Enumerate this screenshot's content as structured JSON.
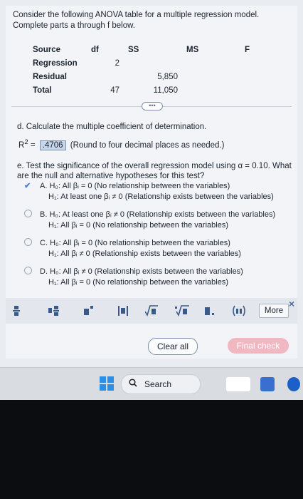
{
  "intro": "Consider the following ANOVA table for a multiple regression model. Complete parts a through f below.",
  "anova": {
    "headers": [
      "Source",
      "df",
      "SS",
      "MS",
      "F"
    ],
    "rows": [
      {
        "source": "Regression",
        "df": "2",
        "ss": "",
        "ms": "",
        "f": ""
      },
      {
        "source": "Residual",
        "df": "",
        "ss": "5,850",
        "ms": "",
        "f": ""
      },
      {
        "source": "Total",
        "df": "47",
        "ss": "11,050",
        "ms": "",
        "f": ""
      }
    ]
  },
  "expand_dots": "•••",
  "part_d": {
    "question": "d. Calculate the multiple coefficient of determination.",
    "r2_label": "R",
    "r2_sup": "2",
    "equals": "=",
    "answer": ".4706",
    "hint": "(Round to four decimal places as needed.)"
  },
  "part_e": {
    "question": "e. Test the significance of the overall regression model using α = 0.10. What are the null and alternative hypotheses for this test?",
    "options": [
      {
        "letter": "A.",
        "h0": "H₀: All βᵢ = 0 (No relationship between the variables)",
        "h1": "H₁: At least one βᵢ ≠ 0 (Relationship exists between the variables)",
        "selected": true
      },
      {
        "letter": "B.",
        "h0": "H₀: At least one βᵢ ≠ 0 (Relationship exists between the variables)",
        "h1": "H₁: All βᵢ = 0 (No relationship between the variables)",
        "selected": false
      },
      {
        "letter": "C.",
        "h0": "H₀: All βᵢ = 0 (No relationship between the variables)",
        "h1": "H₁: All βᵢ ≠ 0 (Relationship exists between the variables)",
        "selected": false
      },
      {
        "letter": "D.",
        "h0": "H₀: All βᵢ ≠ 0 (Relationship exists between the variables)",
        "h1": "H₁: All βᵢ = 0 (No relationship between the variables)",
        "selected": false
      }
    ]
  },
  "toolbar": {
    "icons": [
      "fraction-icon",
      "mixed-number-icon",
      "exponent-icon",
      "absolute-value-icon",
      "square-root-icon",
      "nth-root-icon",
      "decimal-icon",
      "interval-icon"
    ],
    "more_label": "More",
    "close_symbol": "×"
  },
  "actions": {
    "clear_all": "Clear all",
    "final_check": "Final check"
  },
  "taskbar": {
    "search_label": "Search"
  }
}
